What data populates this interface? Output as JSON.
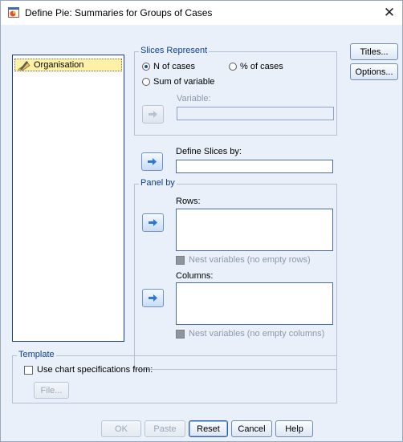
{
  "window": {
    "title": "Define Pie: Summaries for Groups of Cases",
    "close_glyph": "✕"
  },
  "variables": {
    "items": [
      "Organisation"
    ]
  },
  "slices_represent": {
    "legend": "Slices Represent",
    "n_of_cases": "N of cases",
    "pct_of_cases": "% of cases",
    "sum_of_variable": "Sum of variable",
    "variable_label": "Variable:",
    "variable_value": "",
    "selected": "n_of_cases"
  },
  "define_slices": {
    "label": "Define Slices by:",
    "value": ""
  },
  "panel_by": {
    "legend": "Panel by",
    "rows_label": "Rows:",
    "rows_nest": "Nest variables (no empty rows)",
    "columns_label": "Columns:",
    "columns_nest": "Nest variables (no empty columns)"
  },
  "side_buttons": {
    "titles": "Titles...",
    "options": "Options..."
  },
  "template": {
    "legend": "Template",
    "use_spec": "Use chart specifications from:",
    "file": "File..."
  },
  "footer": {
    "ok": "OK",
    "paste": "Paste",
    "reset": "Reset",
    "cancel": "Cancel",
    "help": "Help"
  },
  "colors": {
    "accent": "#0d3f91",
    "dialog_bg": "#e9f0fa",
    "selection": "#fff2a8"
  },
  "icons": {
    "app": "pie-chart-icon",
    "variable": "ruler-pencil-icon",
    "move": "right-arrow-icon"
  }
}
